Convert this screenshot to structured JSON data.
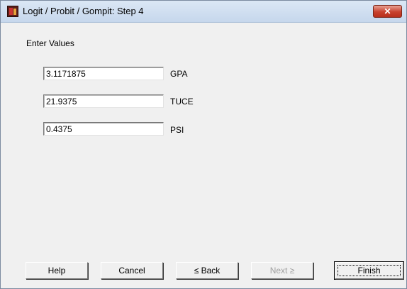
{
  "window": {
    "title": "Logit / Probit / Gompit: Step 4",
    "close_glyph": "✕",
    "icon": "app-icon"
  },
  "form": {
    "section_label": "Enter Values",
    "fields": [
      {
        "value": "3.1171875",
        "label": "GPA"
      },
      {
        "value": "21.9375",
        "label": "TUCE"
      },
      {
        "value": "0.4375",
        "label": "PSI"
      }
    ]
  },
  "buttons": {
    "help": "Help",
    "cancel": "Cancel",
    "back": "≤ Back",
    "next": "Next ≥",
    "finish": "Finish"
  }
}
